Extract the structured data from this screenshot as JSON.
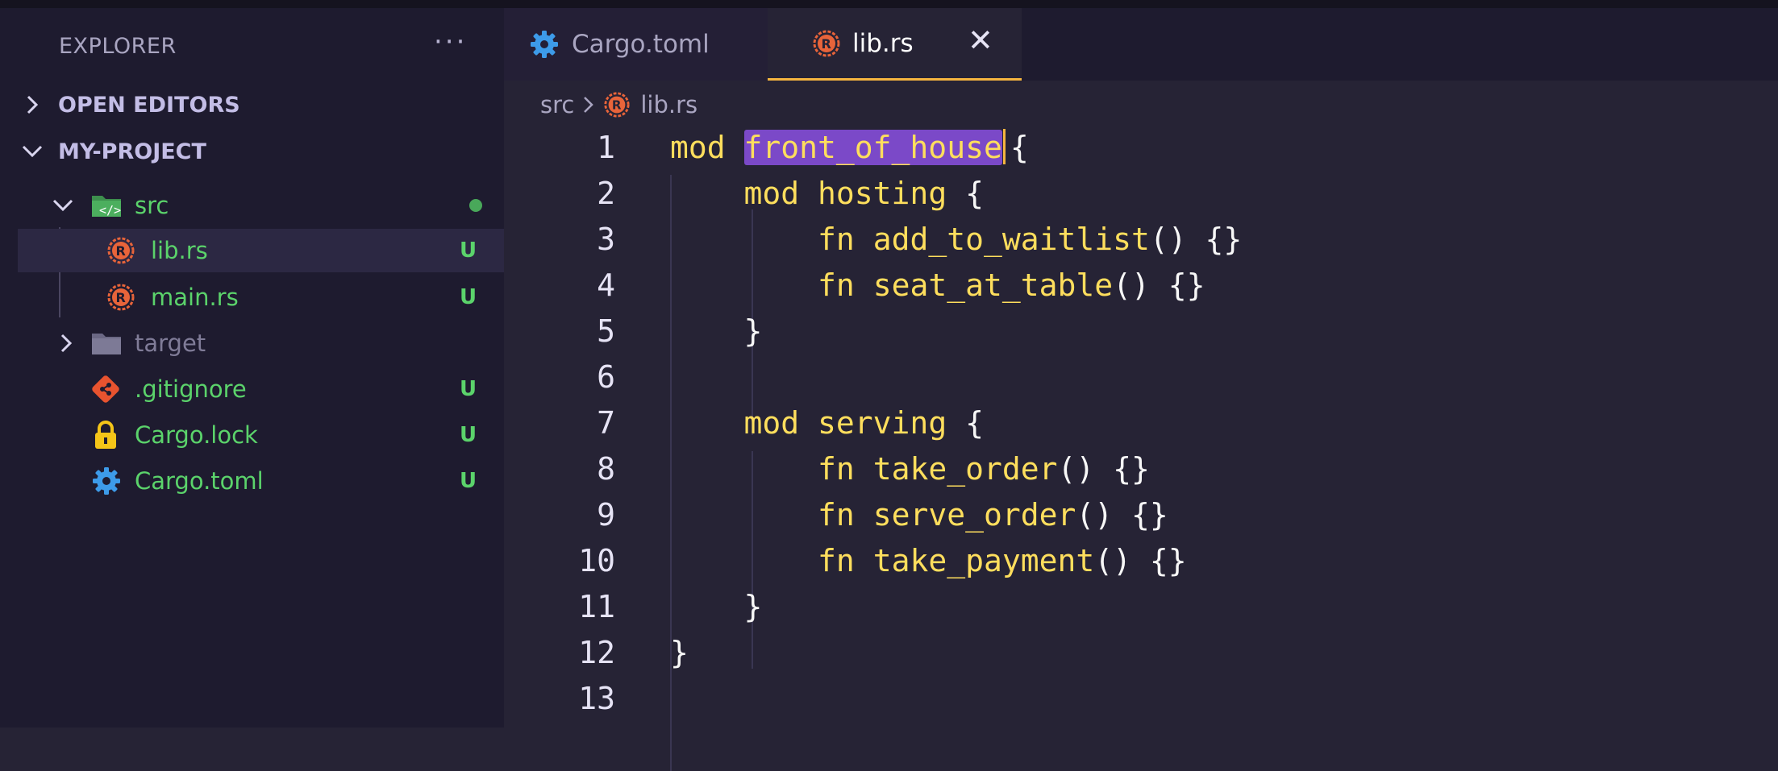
{
  "sidebar": {
    "title": "EXPLORER",
    "more": "···",
    "sections": [
      {
        "label": "OPEN EDITORS",
        "expanded": false
      },
      {
        "label": "MY-PROJECT",
        "expanded": true
      }
    ],
    "tree": [
      {
        "label": "src",
        "icon": "source-folder-icon",
        "badge": "",
        "status": "modified-dot"
      },
      {
        "label": "lib.rs",
        "icon": "rust-file-icon",
        "badge": "U",
        "selected": true
      },
      {
        "label": "main.rs",
        "icon": "rust-file-icon",
        "badge": "U"
      },
      {
        "label": "target",
        "icon": "folder-icon",
        "badge": ""
      },
      {
        "label": ".gitignore",
        "icon": "git-icon",
        "badge": "U"
      },
      {
        "label": "Cargo.lock",
        "icon": "lock-icon",
        "badge": "U"
      },
      {
        "label": "Cargo.toml",
        "icon": "gear-icon",
        "badge": "U"
      }
    ]
  },
  "tabs": [
    {
      "label": "Cargo.toml",
      "icon": "gear-icon",
      "active": false
    },
    {
      "label": "lib.rs",
      "icon": "rust-file-icon",
      "active": true,
      "close": "✕"
    }
  ],
  "breadcrumb": {
    "parts": [
      "src",
      "lib.rs"
    ]
  },
  "editor": {
    "lines": [
      {
        "n": "1",
        "tokens": [
          [
            "kw",
            "mod"
          ],
          [
            "punc",
            " "
          ],
          [
            "sel",
            "front_of_house"
          ],
          [
            "cursor",
            ""
          ],
          [
            "punc",
            "{"
          ]
        ]
      },
      {
        "n": "2",
        "tokens": [
          [
            "punc",
            "    "
          ],
          [
            "kw",
            "mod"
          ],
          [
            "punc",
            " "
          ],
          [
            "name",
            "hosting"
          ],
          [
            "punc",
            " {"
          ]
        ]
      },
      {
        "n": "3",
        "tokens": [
          [
            "punc",
            "        "
          ],
          [
            "kw",
            "fn"
          ],
          [
            "punc",
            " "
          ],
          [
            "name",
            "add_to_waitlist"
          ],
          [
            "punc",
            "() {}"
          ]
        ]
      },
      {
        "n": "4",
        "tokens": [
          [
            "punc",
            "        "
          ],
          [
            "kw",
            "fn"
          ],
          [
            "punc",
            " "
          ],
          [
            "name",
            "seat_at_table"
          ],
          [
            "punc",
            "() {}"
          ]
        ]
      },
      {
        "n": "5",
        "tokens": [
          [
            "punc",
            "    }"
          ]
        ]
      },
      {
        "n": "6",
        "tokens": []
      },
      {
        "n": "7",
        "tokens": [
          [
            "punc",
            "    "
          ],
          [
            "kw",
            "mod"
          ],
          [
            "punc",
            " "
          ],
          [
            "name",
            "serving"
          ],
          [
            "punc",
            " {"
          ]
        ]
      },
      {
        "n": "8",
        "tokens": [
          [
            "punc",
            "        "
          ],
          [
            "kw",
            "fn"
          ],
          [
            "punc",
            " "
          ],
          [
            "name",
            "take_order"
          ],
          [
            "punc",
            "() {}"
          ]
        ]
      },
      {
        "n": "9",
        "tokens": [
          [
            "punc",
            "        "
          ],
          [
            "kw",
            "fn"
          ],
          [
            "punc",
            " "
          ],
          [
            "name",
            "serve_order"
          ],
          [
            "punc",
            "() {}"
          ]
        ]
      },
      {
        "n": "10",
        "tokens": [
          [
            "punc",
            "        "
          ],
          [
            "kw",
            "fn"
          ],
          [
            "punc",
            " "
          ],
          [
            "name",
            "take_payment"
          ],
          [
            "punc",
            "() {}"
          ]
        ]
      },
      {
        "n": "11",
        "tokens": [
          [
            "punc",
            "    }"
          ]
        ]
      },
      {
        "n": "12",
        "tokens": [
          [
            "punc",
            "}"
          ]
        ]
      },
      {
        "n": "13",
        "tokens": []
      }
    ]
  },
  "colors": {
    "background": "#262335",
    "sidebar": "#1e1b2f",
    "untracked_green": "#5bd36b",
    "keyword_yellow": "#fede5d",
    "selection_purple": "#7b49c8",
    "cursor_orange": "#f5b53f",
    "rust_orange": "#e8643a"
  }
}
